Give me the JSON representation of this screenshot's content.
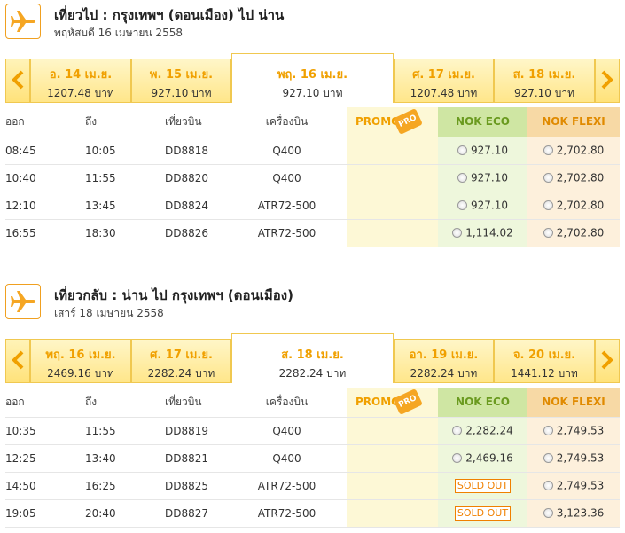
{
  "colors": {
    "accent": "#f0a000",
    "eco": "#cfe6a3",
    "flexi": "#f7d9a5",
    "promo": "#fdf8d6"
  },
  "outbound": {
    "title": "เที่ยวไป  :  กรุงเทพฯ (ดอนเมือง)  ไป  น่าน",
    "date": "พฤหัสบดี 16 เมษายน 2558",
    "dates": [
      {
        "label": "อ. 14 เม.ย.",
        "price": "1207.48 บาท"
      },
      {
        "label": "พ. 15 เม.ย.",
        "price": "927.10 บาท"
      },
      {
        "label": "พฤ. 16 เม.ย.",
        "price": "927.10 บาท"
      },
      {
        "label": "ศ. 17 เม.ย.",
        "price": "1207.48 บาท"
      },
      {
        "label": "ส. 18 เม.ย.",
        "price": "927.10 บาท"
      }
    ],
    "active_index": 2,
    "headers": {
      "dep": "ออก",
      "arr": "ถึง",
      "flight": "เที่ยวบิน",
      "plane": "เครื่องบิน",
      "promo": "PROMOTI",
      "promo_tag": "PRO",
      "eco": "NOK ECO",
      "flexi": "NOK FLEXI"
    },
    "rows": [
      {
        "dep": "08:45",
        "arr": "10:05",
        "flight": "DD8818",
        "plane": "Q400",
        "eco": "927.10",
        "flexi": "2,702.80"
      },
      {
        "dep": "10:40",
        "arr": "11:55",
        "flight": "DD8820",
        "plane": "Q400",
        "eco": "927.10",
        "flexi": "2,702.80"
      },
      {
        "dep": "12:10",
        "arr": "13:45",
        "flight": "DD8824",
        "plane": "ATR72-500",
        "eco": "927.10",
        "flexi": "2,702.80"
      },
      {
        "dep": "16:55",
        "arr": "18:30",
        "flight": "DD8826",
        "plane": "ATR72-500",
        "eco": "1,114.02",
        "flexi": "2,702.80"
      }
    ]
  },
  "return": {
    "title": "เที่ยวกลับ :  น่าน  ไป  กรุงเทพฯ (ดอนเมือง)",
    "date": "เสาร์ 18 เมษายน 2558",
    "dates": [
      {
        "label": "พฤ. 16 เม.ย.",
        "price": "2469.16 บาท"
      },
      {
        "label": "ศ. 17 เม.ย.",
        "price": "2282.24 บาท"
      },
      {
        "label": "ส. 18 เม.ย.",
        "price": "2282.24 บาท"
      },
      {
        "label": "อา. 19 เม.ย.",
        "price": "2282.24 บาท"
      },
      {
        "label": "จ. 20 เม.ย.",
        "price": "1441.12 บาท"
      }
    ],
    "active_index": 2,
    "headers": {
      "dep": "ออก",
      "arr": "ถึง",
      "flight": "เที่ยวบิน",
      "plane": "เครื่องบิน",
      "promo": "PROMOTI",
      "promo_tag": "PRO",
      "eco": "NOK ECO",
      "flexi": "NOK FLEXI"
    },
    "rows": [
      {
        "dep": "10:35",
        "arr": "11:55",
        "flight": "DD8819",
        "plane": "Q400",
        "eco": "2,282.24",
        "flexi": "2,749.53"
      },
      {
        "dep": "12:25",
        "arr": "13:40",
        "flight": "DD8821",
        "plane": "Q400",
        "eco": "2,469.16",
        "flexi": "2,749.53"
      },
      {
        "dep": "14:50",
        "arr": "16:25",
        "flight": "DD8825",
        "plane": "ATR72-500",
        "eco": "SOLD OUT",
        "flexi": "2,749.53"
      },
      {
        "dep": "19:05",
        "arr": "20:40",
        "flight": "DD8827",
        "plane": "ATR72-500",
        "eco": "SOLD OUT",
        "flexi": "3,123.36"
      }
    ]
  }
}
